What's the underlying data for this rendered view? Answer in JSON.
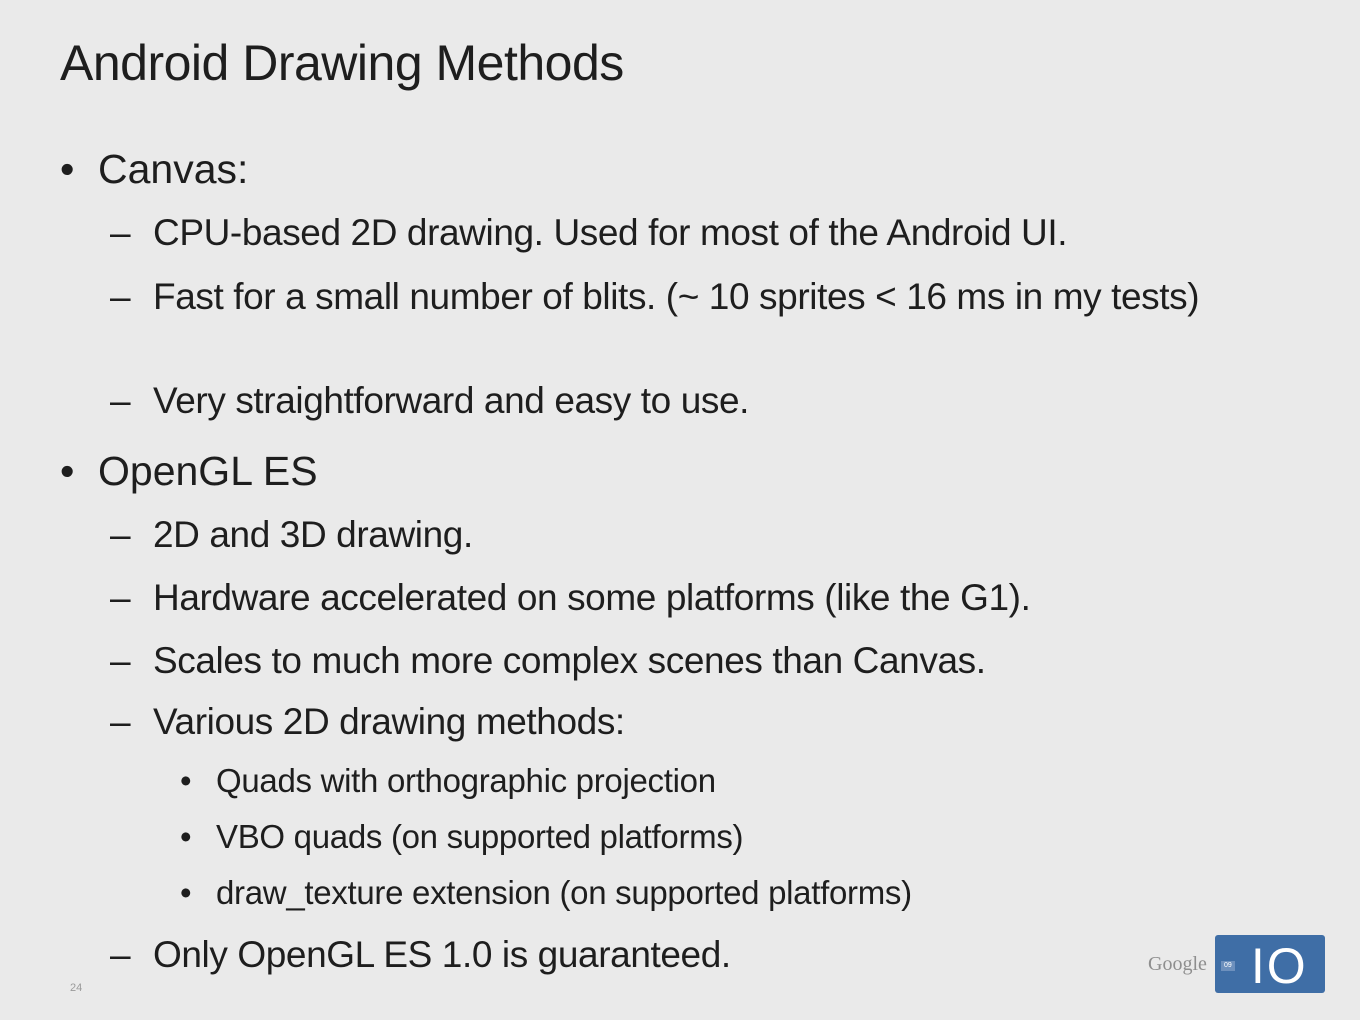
{
  "slide": {
    "title": "Android Drawing Methods",
    "bullet_marker": "•",
    "dash_marker": "–",
    "items": [
      {
        "level": 1,
        "text": "Canvas:"
      },
      {
        "level": 2,
        "text": "CPU-based 2D drawing.  Used for most of the Android UI."
      },
      {
        "level": 2,
        "text": "Fast for a small number of blits. (~ 10 sprites < 16 ms in my tests)"
      },
      {
        "level": 2,
        "text": "Very straightforward and easy to use."
      },
      {
        "level": 1,
        "text": "OpenGL ES"
      },
      {
        "level": 2,
        "text": "2D and 3D drawing."
      },
      {
        "level": 2,
        "text": "Hardware accelerated on some platforms (like the G1)."
      },
      {
        "level": 2,
        "text": "Scales to much more complex scenes than Canvas."
      },
      {
        "level": 2,
        "text": "Various 2D drawing methods:"
      },
      {
        "level": 3,
        "text": "Quads with orthographic projection"
      },
      {
        "level": 3,
        "text": "VBO quads (on supported platforms)"
      },
      {
        "level": 3,
        "text": "draw_texture extension (on supported platforms)"
      },
      {
        "level": 2,
        "text": "Only OpenGL ES 1.0 is guaranteed."
      }
    ],
    "slide_number": "24"
  },
  "logo": {
    "google": "Google",
    "year": "09",
    "io": "IO",
    "brand_color": "#3f6ea6"
  }
}
